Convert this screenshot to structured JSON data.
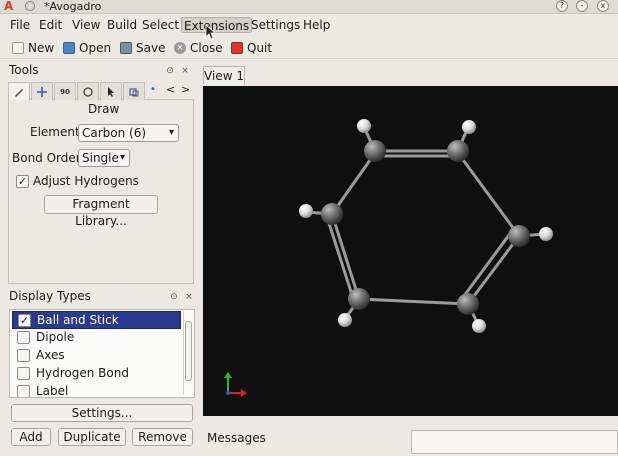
{
  "window": {
    "title": "*Avogadro",
    "logo_text": "A",
    "controls": [
      "?",
      "-",
      "x"
    ]
  },
  "menu": {
    "items": [
      "File",
      "Edit",
      "View",
      "Build",
      "Select",
      "Extensions",
      "Settings",
      "Help"
    ],
    "active": "Extensions"
  },
  "toolbar": {
    "new_label": "New",
    "open_label": "Open",
    "save_label": "Save",
    "close_label": "Close",
    "quit_label": "Quit"
  },
  "tools": {
    "title": "Tools",
    "dock_controls": [
      "⊙",
      "×"
    ],
    "tabs": [
      "draw",
      "navigate",
      "bond-centric",
      "manipulate",
      "select",
      "auto-rotate"
    ],
    "tab_nav": [
      "<",
      ">"
    ],
    "panel_title": "Draw",
    "element_label": "Element:",
    "element_value": "Carbon (6)",
    "bond_order_label": "Bond Order:",
    "bond_order_value": "Single",
    "adjust_hydrogens_label": "Adjust Hydrogens",
    "adjust_hydrogens_checked": true,
    "fragment_button": "Fragment Library..."
  },
  "display_types": {
    "title": "Display Types",
    "items": [
      {
        "label": "Ball and Stick",
        "checked": true,
        "selected": true
      },
      {
        "label": "Dipole",
        "checked": false,
        "selected": false
      },
      {
        "label": "Axes",
        "checked": false,
        "selected": false
      },
      {
        "label": "Hydrogen Bond",
        "checked": false,
        "selected": false
      },
      {
        "label": "Label",
        "checked": false,
        "selected": false
      }
    ],
    "settings_button": "Settings...",
    "add_button": "Add",
    "duplicate_button": "Duplicate",
    "remove_button": "Remove"
  },
  "view": {
    "tab_label": "View 1",
    "background_color": "#0f0f0f",
    "molecule": "benzene-like ring, ball and stick"
  },
  "messages": {
    "label": "Messages"
  },
  "colors": {
    "selection": "#2a3a8e",
    "quit_icon": "#d43a2f",
    "axis_x": "#e0201e",
    "axis_y": "#1fbf1f",
    "axis_z": "#2e48ff"
  }
}
